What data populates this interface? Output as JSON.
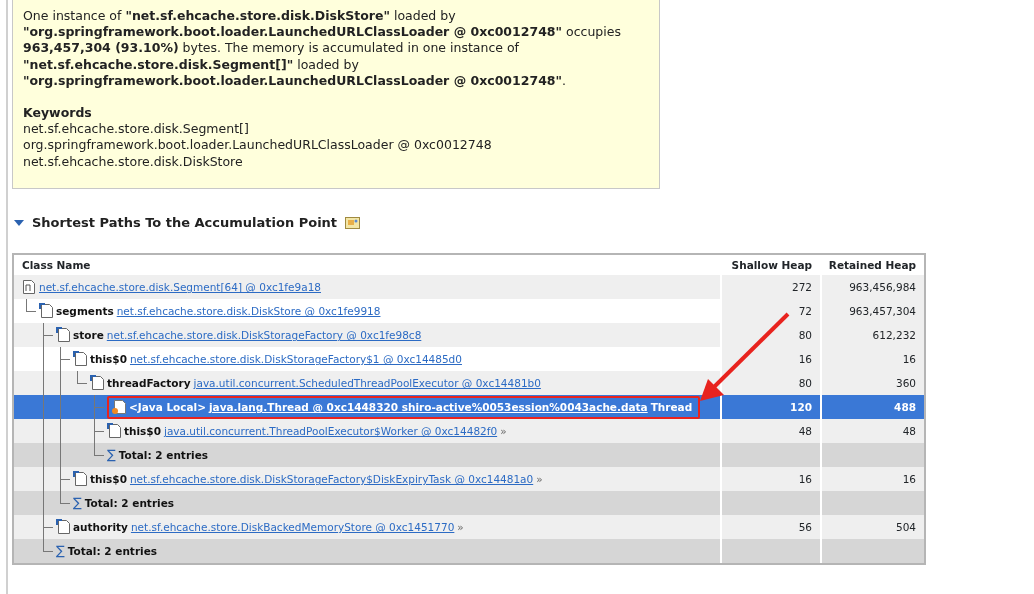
{
  "description": {
    "paragraphs": [
      "One instance of **\"net.sf.ehcache.store.disk.DiskStore\"** loaded by **\"org.springframework.boot.loader.LaunchedURLClassLoader @ 0xc0012748\"** occupies **963,457,304 (93.10%)** bytes. The memory is accumulated in one instance of **\"net.sf.ehcache.store.disk.Segment[]\"** loaded by **\"org.springframework.boot.loader.LaunchedURLClassLoader @ 0xc0012748\"**."
    ],
    "keywords_title": "Keywords",
    "keywords": [
      "net.sf.ehcache.store.disk.Segment[]",
      "org.springframework.boot.loader.LaunchedURLClassLoader @ 0xc0012748",
      "net.sf.ehcache.store.disk.DiskStore"
    ]
  },
  "section": {
    "title": "Shortest Paths To the Accumulation Point",
    "expanded": true
  },
  "table": {
    "columns": [
      "Class Name",
      "Shallow Heap",
      "Retained Heap"
    ],
    "rows": [
      {
        "kind": "array",
        "link": "net.sf.ehcache.store.disk.Segment[64] @ 0xc1fe9a18",
        "shallow": "272",
        "retained": "963,456,984",
        "selected": false,
        "children": [
          {
            "kind": "field",
            "field": "segments",
            "link": "net.sf.ehcache.store.disk.DiskStore @ 0xc1fe9918",
            "shallow": "72",
            "retained": "963,457,304",
            "selected": false,
            "children": [
              {
                "kind": "field",
                "field": "store",
                "link": "net.sf.ehcache.store.disk.DiskStorageFactory @ 0xc1fe98c8",
                "shallow": "80",
                "retained": "612,232",
                "selected": false,
                "children": [
                  {
                    "kind": "field",
                    "field": "this$0",
                    "link": "net.sf.ehcache.store.disk.DiskStorageFactory$1 @ 0xc14485d0",
                    "shallow": "16",
                    "retained": "16",
                    "selected": false,
                    "children": [
                      {
                        "kind": "field",
                        "field": "threadFactory",
                        "link": "java.util.concurrent.ScheduledThreadPoolExecutor @ 0xc14481b0",
                        "shallow": "80",
                        "retained": "360",
                        "selected": false,
                        "children": [
                          {
                            "kind": "local",
                            "field": "<Java Local>",
                            "link": "java.lang.Thread @ 0xc1448320 shiro-active%0053ession%0043ache.data",
                            "suffix": "Thread",
                            "shallow": "120",
                            "retained": "488",
                            "selected": true,
                            "highlighted": true
                          },
                          {
                            "kind": "field",
                            "field": "this$0",
                            "link": "java.util.concurrent.ThreadPoolExecutor$Worker @ 0xc14482f0",
                            "more": "»",
                            "shallow": "48",
                            "retained": "48",
                            "selected": false
                          },
                          {
                            "kind": "total",
                            "symbol": "∑",
                            "label": "Total: 2 entries",
                            "selected": false
                          }
                        ]
                      }
                    ]
                  },
                  {
                    "kind": "field",
                    "field": "this$0",
                    "link": "net.sf.ehcache.store.disk.DiskStorageFactory$DiskExpiryTask @ 0xc14481a0",
                    "more": "»",
                    "shallow": "16",
                    "retained": "16",
                    "selected": false
                  },
                  {
                    "kind": "total",
                    "symbol": "∑",
                    "label": "Total: 2 entries",
                    "selected": false
                  }
                ]
              },
              {
                "kind": "field",
                "field": "authority",
                "link": "net.sf.ehcache.store.DiskBackedMemoryStore @ 0xc1451770",
                "more": "»",
                "shallow": "56",
                "retained": "504",
                "selected": false
              },
              {
                "kind": "total",
                "symbol": "∑",
                "label": "Total: 2 entries",
                "selected": false
              }
            ]
          }
        ]
      }
    ]
  }
}
